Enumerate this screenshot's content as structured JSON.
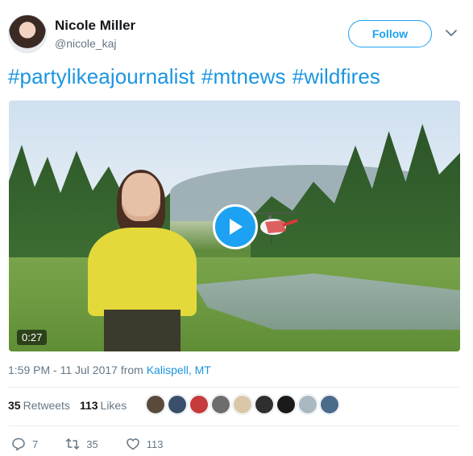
{
  "author": {
    "name": "Nicole Miller",
    "handle": "@nicole_kaj"
  },
  "follow_label": "Follow",
  "tweet": {
    "hashtags": [
      "#partylikeajournalist",
      "#mtnews",
      "#wildfires"
    ]
  },
  "video": {
    "duration": "0:27"
  },
  "meta": {
    "timestamp": "1:59 PM - 11 Jul 2017 from ",
    "location": "Kalispell, MT"
  },
  "stats": {
    "retweets_count": "35",
    "retweets_label": "Retweets",
    "likes_count": "113",
    "likes_label": "Likes"
  },
  "likers": [
    {
      "color": "#5a4a3c"
    },
    {
      "color": "#3a4f6b"
    },
    {
      "color": "#c63b3b"
    },
    {
      "color": "#6d6d6d"
    },
    {
      "color": "#d9c7a8"
    },
    {
      "color": "#2f2f2f"
    },
    {
      "color": "#1a1a1a"
    },
    {
      "color": "#aab8c2"
    },
    {
      "color": "#4a6b8a"
    }
  ],
  "actions": {
    "reply_count": "7",
    "retweet_count": "35",
    "like_count": "113"
  },
  "colors": {
    "accent": "#1da1f2",
    "link": "#1b95e0",
    "muted": "#657786"
  }
}
